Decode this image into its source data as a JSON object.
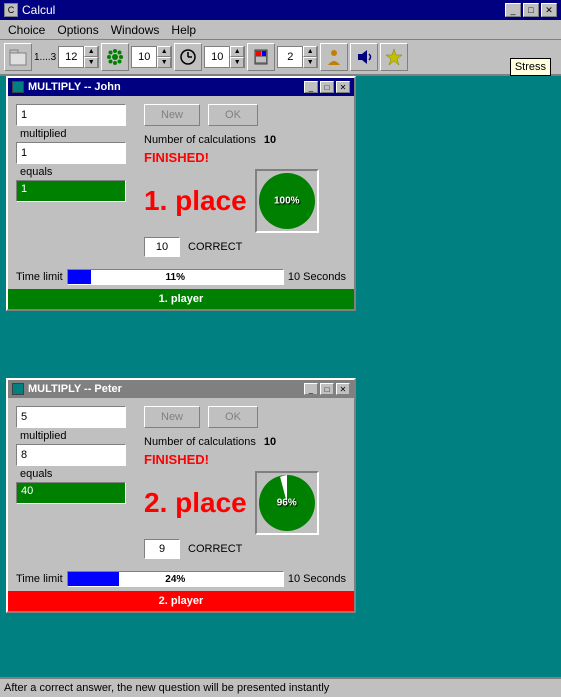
{
  "app": {
    "title": "Calcul",
    "title_icon": "C"
  },
  "menu": {
    "items": [
      "Choice",
      "Options",
      "Windows",
      "Help"
    ]
  },
  "toolbar": {
    "spinner1_val": "12",
    "spinner2_val": "10",
    "spinner3_val": "10",
    "spinner4_val": "2"
  },
  "stress_tooltip": "Stress",
  "john_window": {
    "title": "MULTIPLY  --  John",
    "input1": "1",
    "input2": "1",
    "answer": "1",
    "num_calcs_label": "Number of calculations",
    "num_calcs_value": "10",
    "finished": "FINISHED!",
    "place": "1. place",
    "correct_val": "10",
    "correct_label": "CORRECT",
    "pie_label": "100%",
    "pie_percent": 100,
    "time_label": "Time limit",
    "time_percent": 11,
    "time_bar_text": "11%",
    "time_seconds": "10  Seconds",
    "status": "1. player",
    "btn_new": "New",
    "btn_ok": "OK"
  },
  "peter_window": {
    "title": "MULTIPLY  --  Peter",
    "input1": "5",
    "input2": "8",
    "answer": "40",
    "num_calcs_label": "Number of calculations",
    "num_calcs_value": "10",
    "finished": "FINISHED!",
    "place": "2. place",
    "correct_val": "9",
    "correct_label": "CORRECT",
    "pie_label": "96%",
    "pie_percent": 96,
    "time_label": "Time limit",
    "time_percent": 24,
    "time_bar_text": "24%",
    "time_seconds": "10  Seconds",
    "status": "2. player",
    "btn_new": "New",
    "btn_ok": "OK"
  },
  "status_bar": {
    "text": "After a correct answer, the new question will be presented instantly"
  }
}
